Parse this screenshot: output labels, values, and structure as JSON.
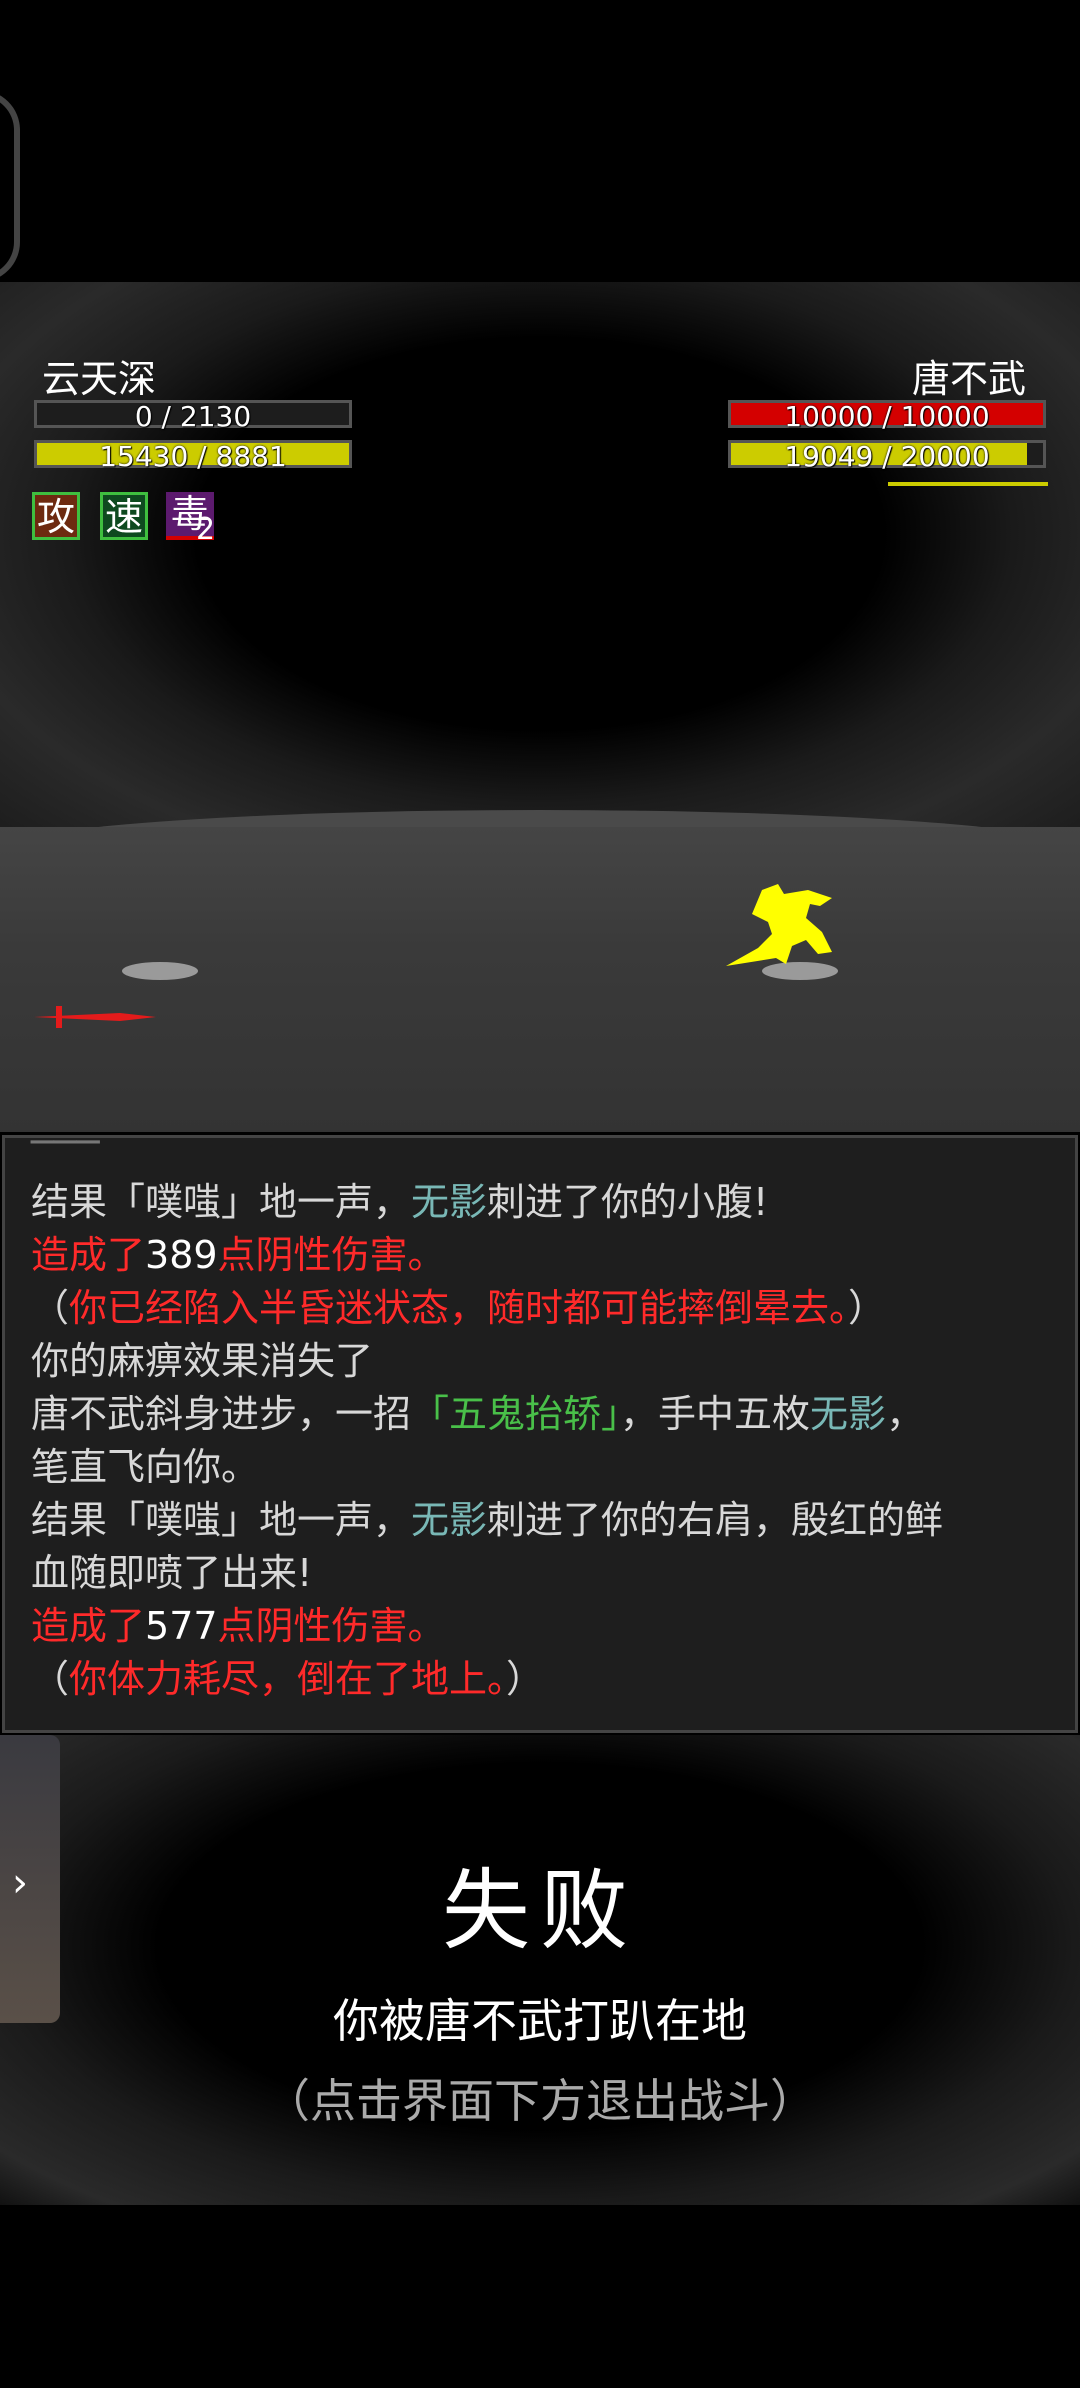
{
  "player": {
    "name": "云天深",
    "hp_label": "0 / 2130",
    "hp_fraction": 0.0,
    "mp_label": "15430 / 8881",
    "mp_fraction": 1.0,
    "buffs": [
      {
        "char": "攻",
        "icon": "attack-buff-icon"
      },
      {
        "char": "速",
        "icon": "speed-buff-icon"
      },
      {
        "char": "毒",
        "icon": "poison-debuff-icon",
        "count": "2"
      }
    ]
  },
  "enemy": {
    "name": "唐不武",
    "hp_label": "10000 / 10000",
    "hp_fraction": 1.0,
    "mp_label": "19049 / 20000",
    "mp_fraction": 0.95
  },
  "colors": {
    "hp_enemy": "#d40000",
    "mp": "#cccc00",
    "hp_player": "#6a6a6a",
    "damage_text": "#ff2a2a",
    "weapon_name": "#79b8b6",
    "skill_name": "#49c049"
  },
  "log": {
    "line1_a": "结果「噗嗤」地一声，",
    "line1_b": "无影",
    "line1_c": "刺进了你的小腹!",
    "line2_a": "造成了",
    "line2_b": "389",
    "line2_c": "点阴性伤害。",
    "line3_a": "（",
    "line3_b": "你已经陷入半昏迷状态，随时都可能摔倒晕去。",
    "line3_c": "）",
    "line4": "你的麻痹效果消失了",
    "line5_a": "唐不武斜身进步，一招",
    "line5_b": "「五鬼抬轿」",
    "line5_c": "，手中五枚",
    "line5_d": "无影",
    "line5_e": "，",
    "line6": "笔直飞向你。",
    "line7_a": "结果「噗嗤」地一声，",
    "line7_b": "无影",
    "line7_c": "刺进了你的右肩，殷红的鲜",
    "line8": "血随即喷了出来!",
    "line9_a": "造成了",
    "line9_b": "577",
    "line9_c": "点阴性伤害。",
    "line10_a": "（",
    "line10_b": "你体力耗尽，倒在了地上。",
    "line10_c": "）"
  },
  "result": {
    "title": "失败",
    "message": "你被唐不武打趴在地",
    "hint": "（点击界面下方退出战斗）"
  },
  "side_tab": {
    "icon": "chevron-right-icon",
    "glyph": "›"
  }
}
